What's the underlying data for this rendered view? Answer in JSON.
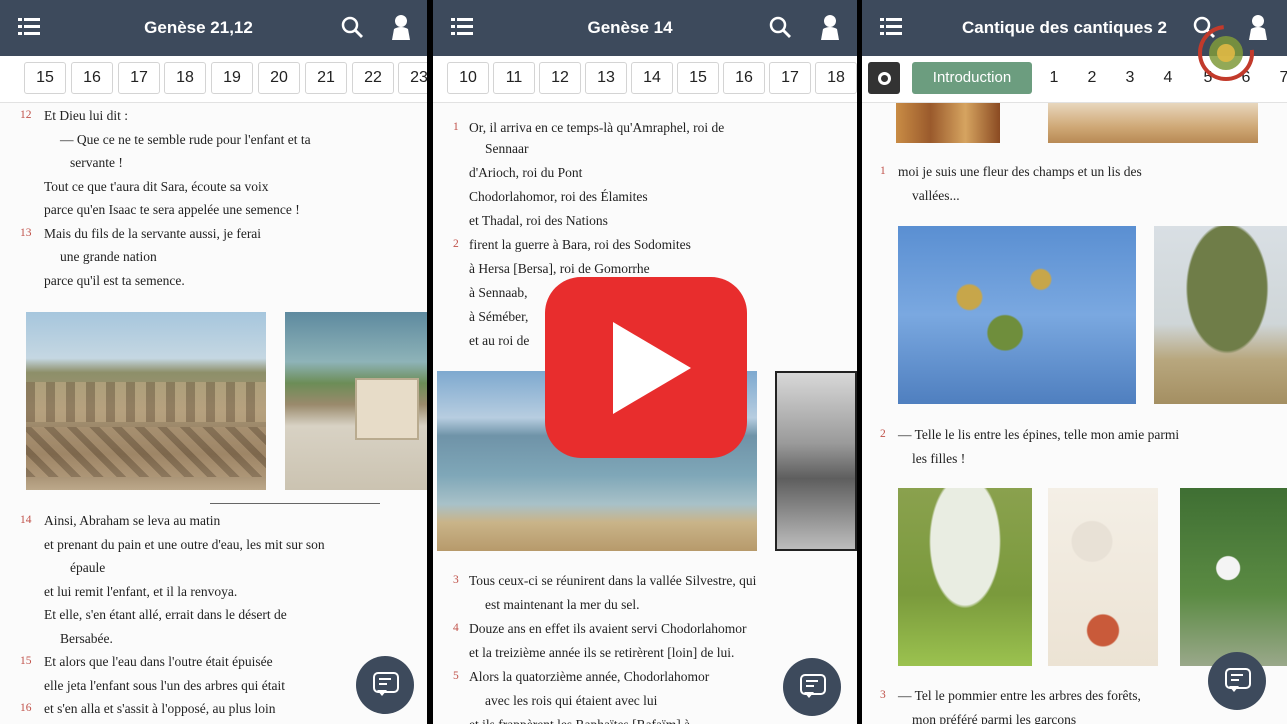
{
  "panels": [
    {
      "title": "Genèse 21,12",
      "tabs": [
        "15",
        "16",
        "17",
        "18",
        "19",
        "20",
        "21",
        "22",
        "23"
      ],
      "lines": [
        {
          "num": "12",
          "text": "Et Dieu lui dit :"
        },
        {
          "num": "",
          "text": "— Que ce ne te semble rude pour l'enfant et ta"
        },
        {
          "num": "",
          "text": "servante !"
        },
        {
          "num": "",
          "text": "Tout ce que t'aura dit Sara, écoute sa voix"
        },
        {
          "num": "",
          "text": "parce qu'en Isaac te sera appelée une semence !"
        },
        {
          "num": "13",
          "text": "Mais du fils de la servante aussi, je ferai"
        },
        {
          "num": "",
          "text": "une grande nation"
        },
        {
          "num": "",
          "text": "parce qu'il est ta semence."
        }
      ],
      "lines2": [
        {
          "num": "14",
          "text": "Ainsi, Abraham se leva au matin"
        },
        {
          "num": "",
          "text": "et prenant du pain et une outre d'eau, les mit sur son"
        },
        {
          "num": "",
          "text": "épaule"
        },
        {
          "num": "",
          "text": "et lui remit l'enfant, et il la renvoya."
        },
        {
          "num": "",
          "text": "Et elle, s'en étant allé, errait dans le désert de"
        },
        {
          "num": "",
          "text": "Bersabée."
        },
        {
          "num": "15",
          "text": "Et alors que l'eau dans l'outre était épuisée"
        },
        {
          "num": "",
          "text": "elle jeta l'enfant sous l'un des arbres qui était"
        },
        {
          "num": "16",
          "text": "et s'en alla et s'assit à l'opposé, au plus loin"
        }
      ]
    },
    {
      "title": "Genèse 14",
      "tabs": [
        "10",
        "11",
        "12",
        "13",
        "14",
        "15",
        "16",
        "17",
        "18"
      ],
      "lines": [
        {
          "num": "1",
          "text": "Or, il arriva en ce temps-là qu'Amraphel, roi de"
        },
        {
          "num": "",
          "text": "Sennaar"
        },
        {
          "num": "",
          "text": "d'Arioch, roi du Pont"
        },
        {
          "num": "",
          "text": "Chodorlahomor, roi des Élamites"
        },
        {
          "num": "",
          "text": "et Thadal, roi des Nations"
        },
        {
          "num": "2",
          "text": "firent la guerre à Bara, roi des Sodomites"
        },
        {
          "num": "",
          "text": "à Hersa [Bersa], roi de Gomorrhe"
        },
        {
          "num": "",
          "text": "à Sennaab,"
        },
        {
          "num": "",
          "text": "à Séméber,"
        },
        {
          "num": "",
          "text": "et au roi de"
        }
      ],
      "lines2": [
        {
          "num": "3",
          "text": "Tous ceux-ci se réunirent dans la vallée Silvestre, qui"
        },
        {
          "num": "",
          "text": "est maintenant la mer du sel."
        },
        {
          "num": "4",
          "text": "Douze ans en effet ils avaient servi Chodorlahomor"
        },
        {
          "num": "",
          "text": "et la treizième année ils se retirèrent [loin] de lui."
        },
        {
          "num": "5",
          "text": "Alors la quatorzième année, Chodorlahomor"
        },
        {
          "num": "",
          "text": "avec les rois qui étaient avec lui"
        },
        {
          "num": "",
          "text": "et ils frappèrent les Raphaïtes [Rafaïm] à"
        }
      ]
    },
    {
      "title": "Cantique des cantiques 2",
      "intro_label": "Introduction",
      "tabs": [
        "1",
        "2",
        "3",
        "4",
        "5",
        "6",
        "7"
      ],
      "lines": [
        {
          "num": "1",
          "text": "moi je suis une fleur des champs et un lis des"
        },
        {
          "num": "",
          "text": "vallées..."
        }
      ],
      "lines2": [
        {
          "num": "2",
          "text": "— Telle le lis entre les épines, telle mon amie parmi"
        },
        {
          "num": "",
          "text": "les filles !"
        }
      ],
      "lines3": [
        {
          "num": "3",
          "text": "— Tel le pommier entre les arbres des forêts,"
        },
        {
          "num": "",
          "text": "mon préféré parmi les garçons"
        }
      ]
    }
  ],
  "icons": {
    "menu": "menu-icon",
    "search": "search-icon",
    "user": "user-icon",
    "settings": "gear-icon",
    "chat": "chat-icon",
    "play": "play-icon"
  },
  "colors": {
    "topbar": "#3d4a5c",
    "verse_number": "#c0524a",
    "intro_tab": "#6c9d7f",
    "play_button": "#e82d2d"
  }
}
